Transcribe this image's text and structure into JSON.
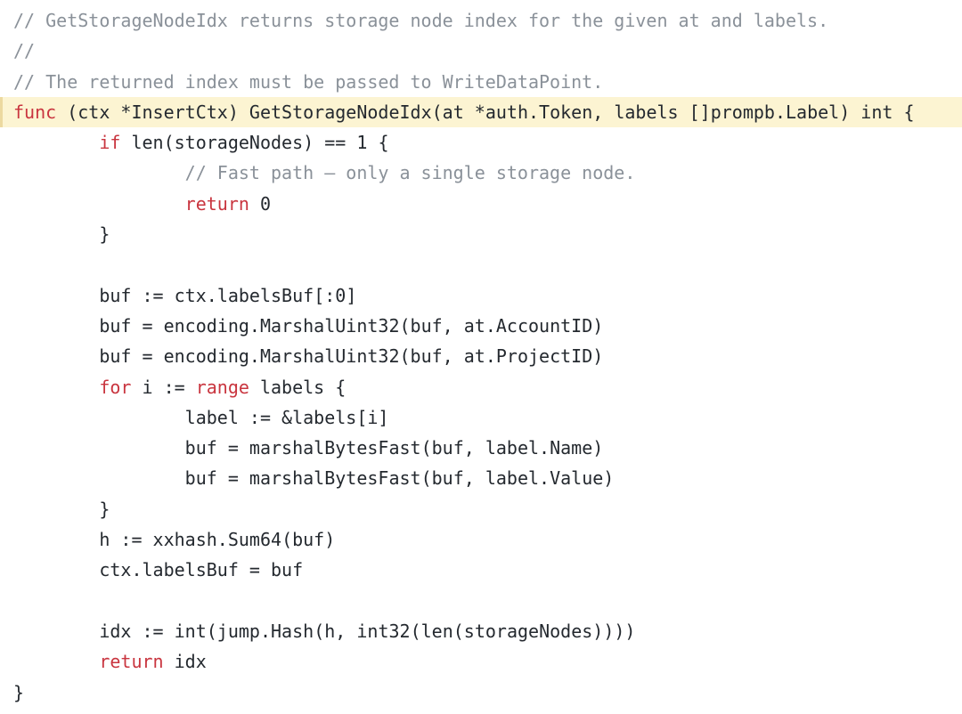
{
  "editor": {
    "language": "go",
    "background_color": "#ffffff",
    "default_text_color": "#24292f",
    "highlight_line_background": "#fcf4d2",
    "highlight_line_border_color": "#ecd9a0",
    "token_colors": {
      "comment": "#8a9199",
      "keyword": "#c9353f",
      "function": "#8a62c9",
      "identifier": "#1f6fc4",
      "operator": "#1f6fc4",
      "number": "#1f6fc4",
      "plain": "#24292f"
    },
    "highlighted_line_number": 4,
    "indent": "    "
  },
  "code": {
    "lines": [
      {
        "id": "line-1",
        "highlighted": false,
        "text": "// GetStorageNodeIdx returns storage node index for the given at and labels.",
        "tokens": [
          {
            "t": "// GetStorageNodeIdx returns storage node index for the given at and labels.",
            "c": "comment"
          }
        ]
      },
      {
        "id": "line-2",
        "highlighted": false,
        "text": "//",
        "tokens": [
          {
            "t": "//",
            "c": "comment"
          }
        ]
      },
      {
        "id": "line-3",
        "highlighted": false,
        "text": "// The returned index must be passed to WriteDataPoint.",
        "tokens": [
          {
            "t": "// The returned index must be passed to WriteDataPoint.",
            "c": "comment"
          }
        ]
      },
      {
        "id": "line-4",
        "highlighted": true,
        "text": "func (ctx *InsertCtx) GetStorageNodeIdx(at *auth.Token, labels []prompb.Label) int {",
        "tokens": [
          {
            "t": "func",
            "c": "keyword"
          },
          {
            "t": " (ctx ",
            "c": "plain"
          },
          {
            "t": "*",
            "c": "operator"
          },
          {
            "t": "InsertCtx) ",
            "c": "plain"
          },
          {
            "t": "GetStorageNodeIdx",
            "c": "function"
          },
          {
            "t": "(at ",
            "c": "plain"
          },
          {
            "t": "*",
            "c": "operator"
          },
          {
            "t": "auth.Token, labels []prompb.Label) int {",
            "c": "plain"
          }
        ]
      },
      {
        "id": "line-5",
        "highlighted": false,
        "text": "        if len(storageNodes) == 1 {",
        "tokens": [
          {
            "t": "        ",
            "c": "plain"
          },
          {
            "t": "if",
            "c": "keyword"
          },
          {
            "t": " ",
            "c": "plain"
          },
          {
            "t": "len",
            "c": "function"
          },
          {
            "t": "(storageNodes) ",
            "c": "plain"
          },
          {
            "t": "==",
            "c": "operator"
          },
          {
            "t": " ",
            "c": "plain"
          },
          {
            "t": "1",
            "c": "number"
          },
          {
            "t": " {",
            "c": "plain"
          }
        ]
      },
      {
        "id": "line-6",
        "highlighted": false,
        "text": "                // Fast path – only a single storage node.",
        "tokens": [
          {
            "t": "                ",
            "c": "plain"
          },
          {
            "t": "// Fast path – only a single storage node.",
            "c": "comment"
          }
        ]
      },
      {
        "id": "line-7",
        "highlighted": false,
        "text": "                return 0",
        "tokens": [
          {
            "t": "                ",
            "c": "plain"
          },
          {
            "t": "return",
            "c": "keyword"
          },
          {
            "t": " ",
            "c": "plain"
          },
          {
            "t": "0",
            "c": "number"
          }
        ]
      },
      {
        "id": "line-8",
        "highlighted": false,
        "text": "        }",
        "tokens": [
          {
            "t": "        }",
            "c": "plain"
          }
        ]
      },
      {
        "id": "line-9",
        "highlighted": false,
        "text": "",
        "tokens": []
      },
      {
        "id": "line-10",
        "highlighted": false,
        "text": "        buf := ctx.labelsBuf[:0]",
        "tokens": [
          {
            "t": "        buf ",
            "c": "plain"
          },
          {
            "t": ":=",
            "c": "operator"
          },
          {
            "t": " ctx.",
            "c": "plain"
          },
          {
            "t": "labelsBuf",
            "c": "identifier"
          },
          {
            "t": "[:",
            "c": "plain"
          },
          {
            "t": "0",
            "c": "number"
          },
          {
            "t": "]",
            "c": "plain"
          }
        ]
      },
      {
        "id": "line-11",
        "highlighted": false,
        "text": "        buf = encoding.MarshalUint32(buf, at.AccountID)",
        "tokens": [
          {
            "t": "        buf ",
            "c": "plain"
          },
          {
            "t": "=",
            "c": "operator"
          },
          {
            "t": " encoding.",
            "c": "plain"
          },
          {
            "t": "MarshalUint32",
            "c": "function"
          },
          {
            "t": "(buf, at.",
            "c": "plain"
          },
          {
            "t": "AccountID",
            "c": "identifier"
          },
          {
            "t": ")",
            "c": "plain"
          }
        ]
      },
      {
        "id": "line-12",
        "highlighted": false,
        "text": "        buf = encoding.MarshalUint32(buf, at.ProjectID)",
        "tokens": [
          {
            "t": "        buf ",
            "c": "plain"
          },
          {
            "t": "=",
            "c": "operator"
          },
          {
            "t": " encoding.",
            "c": "plain"
          },
          {
            "t": "MarshalUint32",
            "c": "function"
          },
          {
            "t": "(buf, at.",
            "c": "plain"
          },
          {
            "t": "ProjectID",
            "c": "identifier"
          },
          {
            "t": ")",
            "c": "plain"
          }
        ]
      },
      {
        "id": "line-13",
        "highlighted": false,
        "text": "        for i := range labels {",
        "tokens": [
          {
            "t": "        ",
            "c": "plain"
          },
          {
            "t": "for",
            "c": "keyword"
          },
          {
            "t": " i ",
            "c": "plain"
          },
          {
            "t": ":=",
            "c": "operator"
          },
          {
            "t": " ",
            "c": "plain"
          },
          {
            "t": "range",
            "c": "keyword"
          },
          {
            "t": " labels {",
            "c": "plain"
          }
        ]
      },
      {
        "id": "line-14",
        "highlighted": false,
        "text": "                label := &labels[i]",
        "tokens": [
          {
            "t": "                label ",
            "c": "plain"
          },
          {
            "t": ":=",
            "c": "operator"
          },
          {
            "t": " ",
            "c": "plain"
          },
          {
            "t": "&",
            "c": "operator"
          },
          {
            "t": "labels[i]",
            "c": "plain"
          }
        ]
      },
      {
        "id": "line-15",
        "highlighted": false,
        "text": "                buf = marshalBytesFast(buf, label.Name)",
        "tokens": [
          {
            "t": "                buf ",
            "c": "plain"
          },
          {
            "t": "=",
            "c": "operator"
          },
          {
            "t": " ",
            "c": "plain"
          },
          {
            "t": "marshalBytesFast",
            "c": "function"
          },
          {
            "t": "(buf, label.",
            "c": "plain"
          },
          {
            "t": "Name",
            "c": "identifier"
          },
          {
            "t": ")",
            "c": "plain"
          }
        ]
      },
      {
        "id": "line-16",
        "highlighted": false,
        "text": "                buf = marshalBytesFast(buf, label.Value)",
        "tokens": [
          {
            "t": "                buf ",
            "c": "plain"
          },
          {
            "t": "=",
            "c": "operator"
          },
          {
            "t": " ",
            "c": "plain"
          },
          {
            "t": "marshalBytesFast",
            "c": "function"
          },
          {
            "t": "(buf, label.",
            "c": "plain"
          },
          {
            "t": "Value",
            "c": "identifier"
          },
          {
            "t": ")",
            "c": "plain"
          }
        ]
      },
      {
        "id": "line-17",
        "highlighted": false,
        "text": "        }",
        "tokens": [
          {
            "t": "        }",
            "c": "plain"
          }
        ]
      },
      {
        "id": "line-18",
        "highlighted": false,
        "text": "        h := xxhash.Sum64(buf)",
        "tokens": [
          {
            "t": "        h ",
            "c": "plain"
          },
          {
            "t": ":=",
            "c": "operator"
          },
          {
            "t": " xxhash.",
            "c": "plain"
          },
          {
            "t": "Sum64",
            "c": "function"
          },
          {
            "t": "(buf)",
            "c": "plain"
          }
        ]
      },
      {
        "id": "line-19",
        "highlighted": false,
        "text": "        ctx.labelsBuf = buf",
        "tokens": [
          {
            "t": "        ctx.",
            "c": "plain"
          },
          {
            "t": "labelsBuf",
            "c": "identifier"
          },
          {
            "t": " ",
            "c": "plain"
          },
          {
            "t": "=",
            "c": "operator"
          },
          {
            "t": " buf",
            "c": "plain"
          }
        ]
      },
      {
        "id": "line-20",
        "highlighted": false,
        "text": "",
        "tokens": []
      },
      {
        "id": "line-21",
        "highlighted": false,
        "text": "        idx := int(jump.Hash(h, int32(len(storageNodes))))",
        "tokens": [
          {
            "t": "        idx ",
            "c": "plain"
          },
          {
            "t": ":=",
            "c": "operator"
          },
          {
            "t": " ",
            "c": "plain"
          },
          {
            "t": "int",
            "c": "function"
          },
          {
            "t": "(jump.",
            "c": "plain"
          },
          {
            "t": "Hash",
            "c": "function"
          },
          {
            "t": "(h, ",
            "c": "plain"
          },
          {
            "t": "int32",
            "c": "function"
          },
          {
            "t": "(",
            "c": "plain"
          },
          {
            "t": "len",
            "c": "function"
          },
          {
            "t": "(storageNodes))))",
            "c": "plain"
          }
        ]
      },
      {
        "id": "line-22",
        "highlighted": false,
        "text": "        return idx",
        "tokens": [
          {
            "t": "        ",
            "c": "plain"
          },
          {
            "t": "return",
            "c": "keyword"
          },
          {
            "t": " idx",
            "c": "plain"
          }
        ]
      },
      {
        "id": "line-23",
        "highlighted": false,
        "text": "}",
        "tokens": [
          {
            "t": "}",
            "c": "plain"
          }
        ]
      }
    ]
  }
}
